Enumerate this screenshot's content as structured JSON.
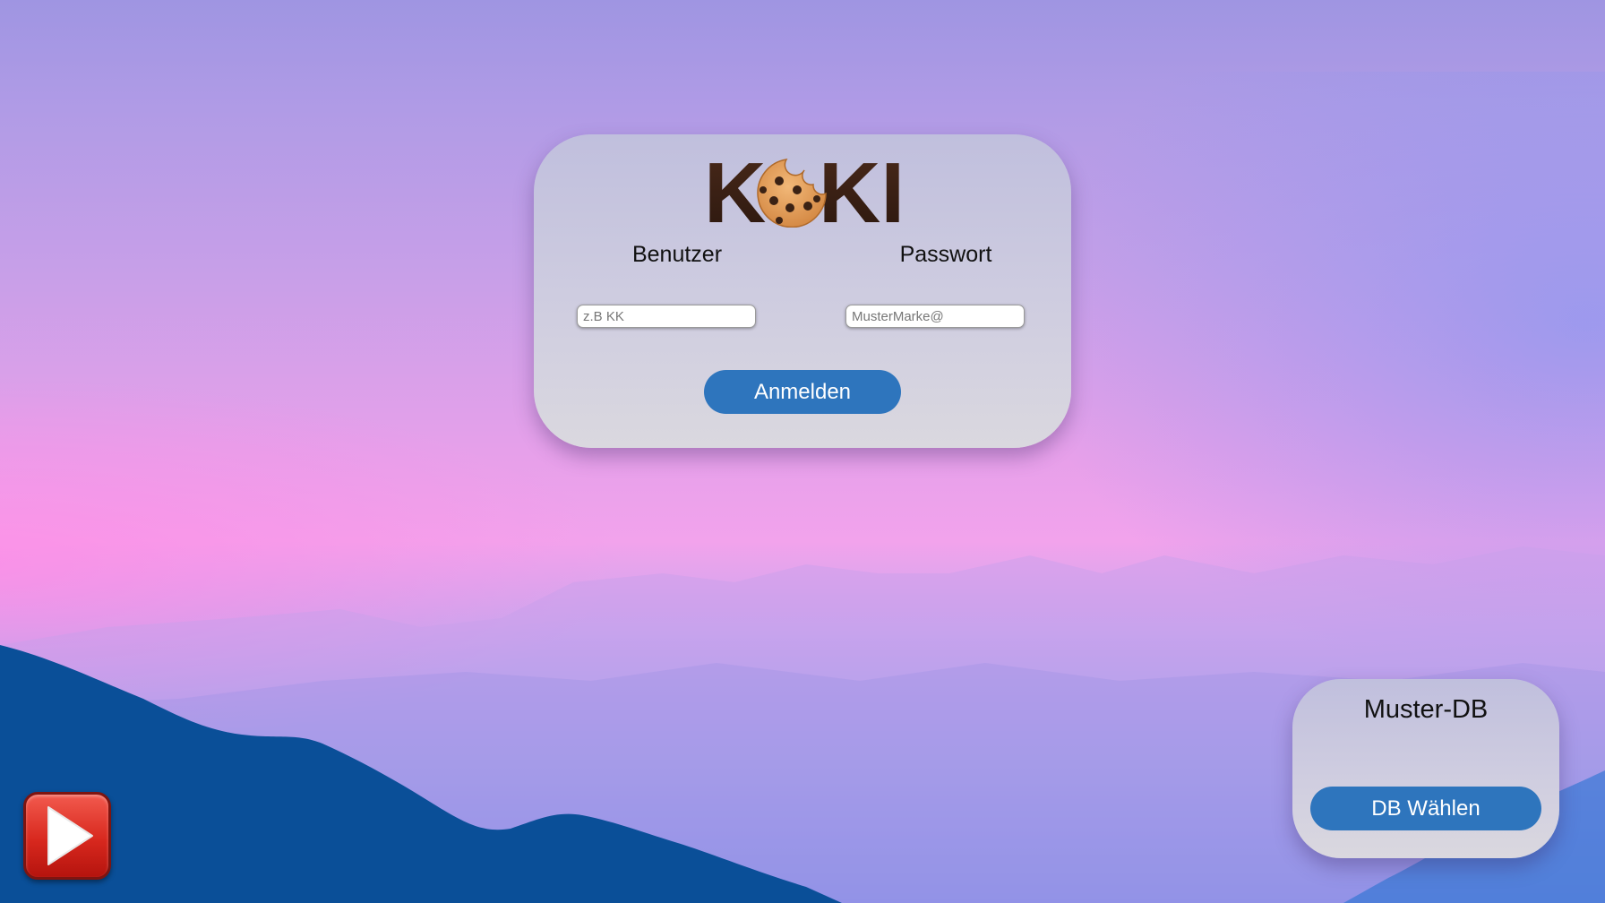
{
  "logo": {
    "text_left": "K",
    "text_right": "KI",
    "icon": "cookie-icon"
  },
  "login": {
    "user_label": "Benutzer",
    "password_label": "Passwort",
    "user_placeholder": "z.B KK",
    "password_placeholder": "MusterMarke@",
    "submit_label": "Anmelden"
  },
  "database": {
    "title": "Muster-DB",
    "select_label": "DB Wählen"
  },
  "media": {
    "play_icon": "play-icon"
  },
  "colors": {
    "accent": "#2e75bd",
    "card": "#cfcde0",
    "play": "#d8281e"
  }
}
